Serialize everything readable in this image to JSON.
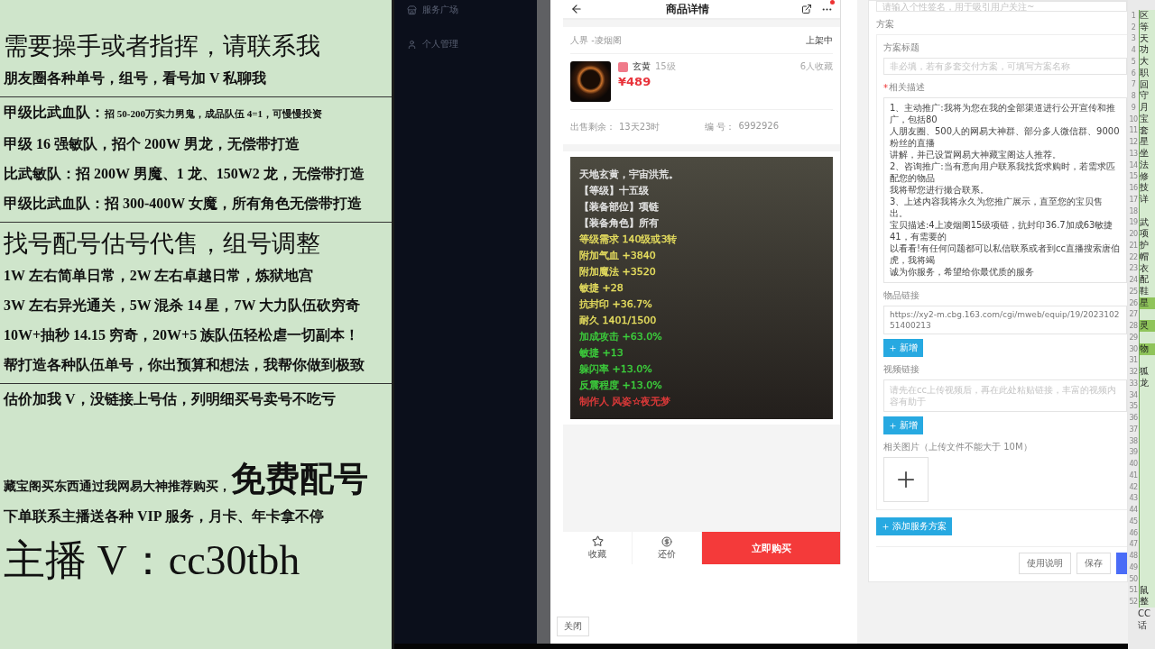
{
  "ad_panel": {
    "sections": [
      {
        "lines": [
          {
            "kind": "heading",
            "text": "需要操手或者指挥，请联系我"
          },
          {
            "kind": "line",
            "text": "朋友圈各种单号，组号，看号加 V 私聊我"
          }
        ]
      },
      {
        "lines": [
          {
            "kind": "split",
            "text": "甲级比武血队：",
            "detail": "招 50-200万实力男鬼，成品队伍 4=1，可慢慢投资"
          },
          {
            "kind": "line",
            "text": "甲级 16 强敏队，招个 200W 男龙，无偿带打造"
          },
          {
            "kind": "line",
            "text": "比武敏队：招 200W 男魔、1 龙、150W2 龙，无偿带打造"
          },
          {
            "kind": "line",
            "text": "甲级比武血队：招 300-400W 女魔，所有角色无偿带打造"
          }
        ]
      },
      {
        "lines": [
          {
            "kind": "heading",
            "text": "找号配号估号代售，组号调整"
          },
          {
            "kind": "line",
            "text": "1W 左右简单日常，2W 左右卓越日常，炼狱地宫"
          },
          {
            "kind": "line",
            "text": "3W 左右异光通关，5W 混杀 14 星，7W 大力队伍砍穷奇"
          },
          {
            "kind": "line",
            "text": "10W+抽秒 14.15 穷奇，20W+5 族队伍轻松虐一切副本！"
          },
          {
            "kind": "line",
            "text": "帮打造各种队伍单号，你出预算和想法，我帮你做到极致"
          }
        ]
      },
      {
        "lines": [
          {
            "kind": "line",
            "text": "估价加我 V，没链接上号估，列明细买号卖号不吃亏"
          },
          {
            "kind": "promo",
            "text": "藏宝阁买东西通过我网易大神推荐购买，",
            "detail": "免费配号"
          },
          {
            "kind": "line",
            "text": "下单联系主播送各种 VIP 服务，月卡、年卡拿不停"
          },
          {
            "kind": "giant",
            "text": "主播 V：cc30tbh"
          }
        ]
      }
    ]
  },
  "sidebar": {
    "items": [
      {
        "label": "服务广场"
      },
      {
        "label": "个人管理"
      }
    ]
  },
  "phone": {
    "title": "商品详情",
    "location": "人界 -凌烟阁",
    "status": "上架中",
    "item": {
      "quality": "玄黄",
      "level": "15级",
      "favorites": "6人收藏",
      "price": "¥489"
    },
    "remaining_label": "出售剩余：",
    "remaining": "13天23时",
    "number_label": "编 号：",
    "number": "6992926",
    "stats": [
      {
        "text": "天地玄黄，宇宙洪荒。",
        "color": "#e6e6e6"
      },
      {
        "text": "【等级】十五级",
        "color": "#e6e6e6"
      },
      {
        "text": "【装备部位】项链",
        "color": "#e6e6e6"
      },
      {
        "text": "【装备角色】所有",
        "color": "#e6e6e6"
      },
      {
        "text": "等级需求 140级或3转",
        "color": "#e6de5e"
      },
      {
        "text": "附加气血 +3840",
        "color": "#e6de5e"
      },
      {
        "text": "附加魔法 +3520",
        "color": "#e6de5e"
      },
      {
        "text": "敏捷 +28",
        "color": "#e6de5e"
      },
      {
        "text": "抗封印 +36.7%",
        "color": "#e6de5e"
      },
      {
        "text": "耐久 1401/1500",
        "color": "#e6de5e"
      },
      {
        "text": "加成攻击 +63.0%",
        "color": "#3ccf3c"
      },
      {
        "text": "敏捷 +13",
        "color": "#3ccf3c"
      },
      {
        "text": "躲闪率 +13.0%",
        "color": "#3ccf3c"
      },
      {
        "text": "反震程度 +13.0%",
        "color": "#3ccf3c"
      },
      {
        "text": "制作人 风姿☆夜无梦",
        "color": "#e03a3a"
      }
    ],
    "actions": [
      {
        "label": "收藏"
      },
      {
        "label": "还价"
      }
    ],
    "buy_button": "立即购买"
  },
  "close_button": "关闭",
  "form": {
    "signature_placeholder": "请输入个性签名，用于吸引用户关注~",
    "section_title": "方案",
    "title_label": "方案标题",
    "title_placeholder": "非必填，若有多套交付方案，可填写方案名称",
    "required_mark": "*",
    "description_label": "相关描述",
    "description": [
      "1、主动推广:我将为您在我的全部渠道进行公开宣传和推广，包括80",
      "人朋友圈、500人的网易大神群、部分多人微信群、9000粉丝的直播",
      "讲解，并已设置网易大神藏宝阁达人推荐。",
      "2、咨询推广:当有意向用户联系我找货求购时，若需求匹配您的物品",
      "我将帮您进行撮合联系。",
      "3、上述内容我将永久为您推广展示，直至您的宝贝售出。",
      "宝贝描述:4上凌烟阁15级项链，抗封印36.7加成63敏捷41，有需要的",
      "以看看!有任何问题都可以私信联系或者到cc直播搜索唐伯虎，我将竭",
      "诚为你服务，希望给你最优质的服务"
    ],
    "link_label": "物品链接",
    "link_value": "https://xy2-m.cbg.163.com/cgi/mweb/equip/19/202310251400213",
    "add_button": "新增",
    "video_label": "视频链接",
    "video_placeholder": "请先在cc上传视频后，再在此处粘贴链接，丰富的视频内容有助于",
    "video_add_button": "新增",
    "image_label": "相关图片（上传文件不能大于 10M）",
    "add_plan_button": "添加服务方案",
    "footer_buttons": [
      "使用说明",
      "保存"
    ]
  },
  "sheet": {
    "rows": [
      {
        "num": "1",
        "text": "区",
        "highlight": false
      },
      {
        "num": "2",
        "text": "等",
        "highlight": false
      },
      {
        "num": "3",
        "text": "天",
        "highlight": false
      },
      {
        "num": "4",
        "text": "功",
        "highlight": false
      },
      {
        "num": "5",
        "text": "大",
        "highlight": false
      },
      {
        "num": "6",
        "text": "职",
        "highlight": false
      },
      {
        "num": "7",
        "text": "回",
        "highlight": false
      },
      {
        "num": "8",
        "text": "守",
        "highlight": false
      },
      {
        "num": "9",
        "text": "月",
        "highlight": false
      },
      {
        "num": "10",
        "text": "宝",
        "highlight": false
      },
      {
        "num": "11",
        "text": "套",
        "highlight": false
      },
      {
        "num": "12",
        "text": "星",
        "highlight": false
      },
      {
        "num": "13",
        "text": "坐",
        "highlight": false
      },
      {
        "num": "14",
        "text": "法",
        "highlight": false
      },
      {
        "num": "15",
        "text": "修",
        "highlight": false
      },
      {
        "num": "16",
        "text": "技",
        "highlight": false
      },
      {
        "num": "17",
        "text": "详",
        "highlight": false
      },
      {
        "num": "18",
        "highlight": false
      },
      {
        "num": "19",
        "text": "武",
        "highlight": false
      },
      {
        "num": "20",
        "text": "项",
        "highlight": false
      },
      {
        "num": "21",
        "text": "护",
        "highlight": false
      },
      {
        "num": "22",
        "text": "帽",
        "highlight": false
      },
      {
        "num": "23",
        "text": "衣",
        "highlight": false
      },
      {
        "num": "24",
        "text": "配",
        "highlight": false
      },
      {
        "num": "25",
        "text": "鞋",
        "highlight": false
      },
      {
        "num": "26",
        "text": "星",
        "highlight": true
      },
      {
        "num": "27",
        "highlight": false
      },
      {
        "num": "28",
        "text": "灵",
        "highlight": true
      },
      {
        "num": "29",
        "highlight": false
      },
      {
        "num": "30",
        "text": "物",
        "highlight": true
      },
      {
        "num": "31",
        "highlight": false
      },
      {
        "num": "32",
        "text": "狐",
        "highlight": false
      },
      {
        "num": "33",
        "text": "龙",
        "highlight": false
      },
      {
        "num": "34",
        "highlight": false
      },
      {
        "num": "35",
        "highlight": false
      },
      {
        "num": "36",
        "highlight": false
      },
      {
        "num": "37",
        "highlight": false
      },
      {
        "num": "38",
        "highlight": false
      },
      {
        "num": "39",
        "highlight": false
      },
      {
        "num": "40",
        "highlight": false
      },
      {
        "num": "41",
        "highlight": false
      },
      {
        "num": "42",
        "highlight": false
      },
      {
        "num": "43",
        "highlight": false
      },
      {
        "num": "44",
        "highlight": false
      },
      {
        "num": "45",
        "highlight": false
      },
      {
        "num": "46",
        "highlight": false
      },
      {
        "num": "47",
        "highlight": false
      },
      {
        "num": "48",
        "highlight": false
      },
      {
        "num": "49",
        "highlight": false
      },
      {
        "num": "50",
        "highlight": false
      },
      {
        "num": "51",
        "text": "鼠",
        "highlight": false
      },
      {
        "num": "52",
        "text": "整",
        "highlight": false
      }
    ],
    "footer": [
      "CC",
      "话"
    ]
  }
}
